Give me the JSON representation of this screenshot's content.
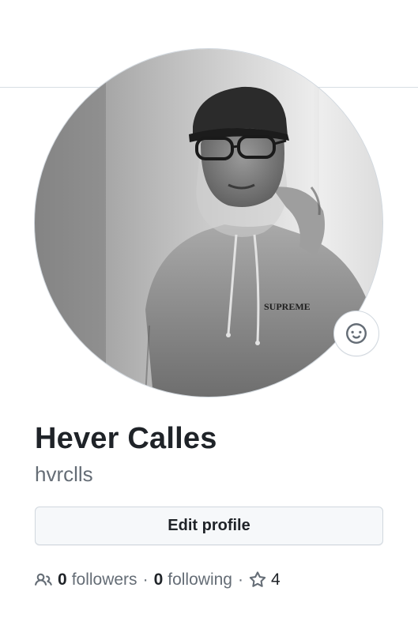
{
  "profile": {
    "full_name": "Hever Calles",
    "username": "hvrclls",
    "avatar_alt": "profile photo of a person wearing a cap, glasses and a SUPREME hoodie",
    "avatar_hoodie_text": "SUPREME"
  },
  "actions": {
    "edit_profile_label": "Edit profile",
    "status_icon": "smiley-icon"
  },
  "stats": {
    "followers_count": "0",
    "followers_label": "followers",
    "following_count": "0",
    "following_label": "following",
    "separator": "·",
    "stars_count": "4",
    "people_icon": "people-icon",
    "star_icon": "star-icon"
  },
  "colors": {
    "text_primary": "#1f2328",
    "text_muted": "#656d76",
    "border": "#d0d7de",
    "button_bg": "#f6f8fa"
  }
}
